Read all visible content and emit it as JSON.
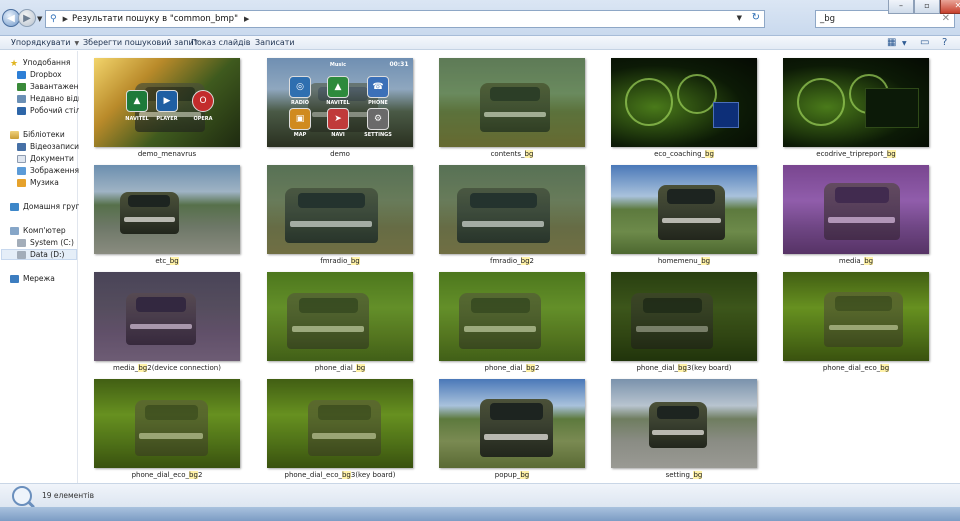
{
  "address": {
    "path": "Результати пошуку в \"common_bmp\"",
    "search_value": "_bg"
  },
  "toolbar": {
    "organize": "Упорядкувати",
    "save_search": "Зберегти пошуковий запит",
    "slideshow": "Показ слайдів",
    "burn": "Записати"
  },
  "sidebar": {
    "favorites": "Уподобання",
    "dropbox": "Dropbox",
    "downloads": "Завантаження",
    "recent": "Недавно відві",
    "desktop": "Робочий стіл",
    "libraries": "Бібліотеки",
    "videos": "Відеозаписи",
    "documents": "Документи",
    "pictures": "Зображення",
    "music": "Музика",
    "homegroup": "Домашня група",
    "computer": "Комп'ютер",
    "system": "System (C:)",
    "data": "Data (D:)",
    "network": "Мережа"
  },
  "thumb_labels": {
    "navitel": "NAVITEL",
    "player": "PLAYER",
    "opera": "OPERA",
    "radio": "RADIO",
    "navitel2": "NAVITEL",
    "phone": "PHONE",
    "map": "MAP",
    "navi": "NAVI",
    "settings": "SETTINGS",
    "music": "Music",
    "clock": "00:31"
  },
  "files": [
    {
      "pre": "demo_menavrus",
      "hl": "",
      "post": ""
    },
    {
      "pre": "demo",
      "hl": "",
      "post": ""
    },
    {
      "pre": "contents_",
      "hl": "bg",
      "post": ""
    },
    {
      "pre": "eco_coaching_",
      "hl": "bg",
      "post": ""
    },
    {
      "pre": "ecodrive_tripreport_",
      "hl": "bg",
      "post": ""
    },
    {
      "pre": "etc_",
      "hl": "bg",
      "post": ""
    },
    {
      "pre": "fmradio_",
      "hl": "bg",
      "post": ""
    },
    {
      "pre": "fmradio_",
      "hl": "bg",
      "post": "2"
    },
    {
      "pre": "homemenu_",
      "hl": "bg",
      "post": ""
    },
    {
      "pre": "media_",
      "hl": "bg",
      "post": ""
    },
    {
      "pre": "media_",
      "hl": "bg",
      "post": "2(device connection)"
    },
    {
      "pre": "phone_dial_",
      "hl": "bg",
      "post": ""
    },
    {
      "pre": "phone_dial_",
      "hl": "bg",
      "post": "2"
    },
    {
      "pre": "phone_dial_",
      "hl": "bg",
      "post": "3(key board)"
    },
    {
      "pre": "phone_dial_eco_",
      "hl": "bg",
      "post": ""
    },
    {
      "pre": "phone_dial_eco_",
      "hl": "bg",
      "post": "2"
    },
    {
      "pre": "phone_dial_eco_",
      "hl": "bg",
      "post": "3(key board)"
    },
    {
      "pre": "popup_",
      "hl": "bg",
      "post": ""
    },
    {
      "pre": "setting_",
      "hl": "bg",
      "post": ""
    }
  ],
  "status": {
    "count": "19 елементів"
  }
}
